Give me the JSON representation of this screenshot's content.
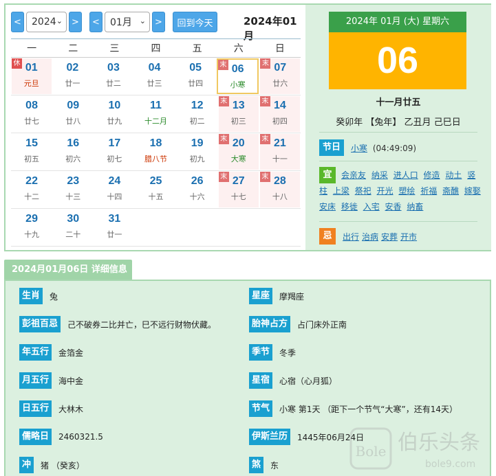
{
  "toolbar": {
    "prev": "<",
    "next": ">",
    "year": "2024",
    "month": "01月",
    "today_btn": "回到今天",
    "title": "2024年01月"
  },
  "weekdays": [
    "一",
    "二",
    "三",
    "四",
    "五",
    "六",
    "日"
  ],
  "weeks": [
    [
      {
        "d": "01",
        "l": "元旦",
        "tag": "休",
        "lc": "red",
        "bg": "hol"
      },
      {
        "d": "02",
        "l": "廿一"
      },
      {
        "d": "03",
        "l": "廿二"
      },
      {
        "d": "04",
        "l": "廿三"
      },
      {
        "d": "05",
        "l": "廿四"
      },
      {
        "d": "06",
        "l": "小寒",
        "tag": "末",
        "lc": "green",
        "bg": "today"
      },
      {
        "d": "07",
        "l": "廿六",
        "tag": "末",
        "bg": "wk"
      }
    ],
    [
      {
        "d": "08",
        "l": "廿七"
      },
      {
        "d": "09",
        "l": "廿八"
      },
      {
        "d": "10",
        "l": "廿九"
      },
      {
        "d": "11",
        "l": "十二月",
        "lc": "green"
      },
      {
        "d": "12",
        "l": "初二"
      },
      {
        "d": "13",
        "l": "初三",
        "tag": "末",
        "bg": "wk"
      },
      {
        "d": "14",
        "l": "初四",
        "tag": "末",
        "bg": "wk"
      }
    ],
    [
      {
        "d": "15",
        "l": "初五"
      },
      {
        "d": "16",
        "l": "初六"
      },
      {
        "d": "17",
        "l": "初七"
      },
      {
        "d": "18",
        "l": "腊八节",
        "lc": "red"
      },
      {
        "d": "19",
        "l": "初九"
      },
      {
        "d": "20",
        "l": "大寒",
        "tag": "末",
        "lc": "green",
        "bg": "wk"
      },
      {
        "d": "21",
        "l": "十一",
        "tag": "末",
        "bg": "wk"
      }
    ],
    [
      {
        "d": "22",
        "l": "十二"
      },
      {
        "d": "23",
        "l": "十三"
      },
      {
        "d": "24",
        "l": "十四"
      },
      {
        "d": "25",
        "l": "十五"
      },
      {
        "d": "26",
        "l": "十六"
      },
      {
        "d": "27",
        "l": "十七",
        "tag": "末",
        "bg": "wk"
      },
      {
        "d": "28",
        "l": "十八",
        "tag": "末",
        "bg": "wk"
      }
    ],
    [
      {
        "d": "29",
        "l": "十九"
      },
      {
        "d": "30",
        "l": "二十"
      },
      {
        "d": "31",
        "l": "廿一"
      },
      null,
      null,
      null,
      null
    ]
  ],
  "side": {
    "date_header": "2024年 01月 (大) 星期六",
    "day": "06",
    "lunar": "十一月廿五",
    "ganzhi": "癸卯年 【兔年】 乙丑月 己巳日",
    "festival_label": "节日",
    "festival_name": "小寒",
    "festival_time": "(04:49:09)",
    "yi_label": "宜",
    "yi_items": [
      "会亲友",
      "纳采",
      "进人口",
      "修造",
      "动土",
      "竖柱",
      "上梁",
      "祭祀",
      "开光",
      "塑绘",
      "祈福",
      "斋醮",
      "嫁娶",
      "安床",
      "移徙",
      "入宅",
      "安香",
      "纳畜"
    ],
    "ji_label": "忌",
    "ji_items": [
      "出行",
      "治病",
      "安葬",
      "开市"
    ]
  },
  "detail": {
    "tab": "2024月01月06日 详细信息",
    "items": [
      {
        "k": "生肖",
        "v": "兔"
      },
      {
        "k": "星座",
        "v": "摩羯座"
      },
      {
        "k": "彭祖百忌",
        "v": "己不破券二比并亡，巳不远行财物伏藏。"
      },
      {
        "k": "胎神占方",
        "v": "占门床外正南"
      },
      {
        "k": "年五行",
        "v": "金箔金"
      },
      {
        "k": "季节",
        "v": "冬季"
      },
      {
        "k": "月五行",
        "v": "海中金"
      },
      {
        "k": "星宿",
        "v": "心宿（心月狐）"
      },
      {
        "k": "日五行",
        "v": "大林木"
      },
      {
        "k": "节气",
        "v": "小寒 第1天 （距下一个节气“大寒”，还有14天）"
      },
      {
        "k": "儒略日",
        "v": "2460321.5"
      },
      {
        "k": "伊斯兰历",
        "v": "1445年06月24日"
      },
      {
        "k": "冲",
        "v": "猪 （癸亥）"
      },
      {
        "k": "煞",
        "v": "东"
      }
    ]
  },
  "watermark": {
    "brand": "Bole",
    "cn": "伯乐头条",
    "url": "bole9.com"
  },
  "colors": {
    "accent_blue": "#4da6e8",
    "green": "#3aa04a",
    "gold": "#ffb400",
    "label_blue": "#1aa0d0"
  }
}
